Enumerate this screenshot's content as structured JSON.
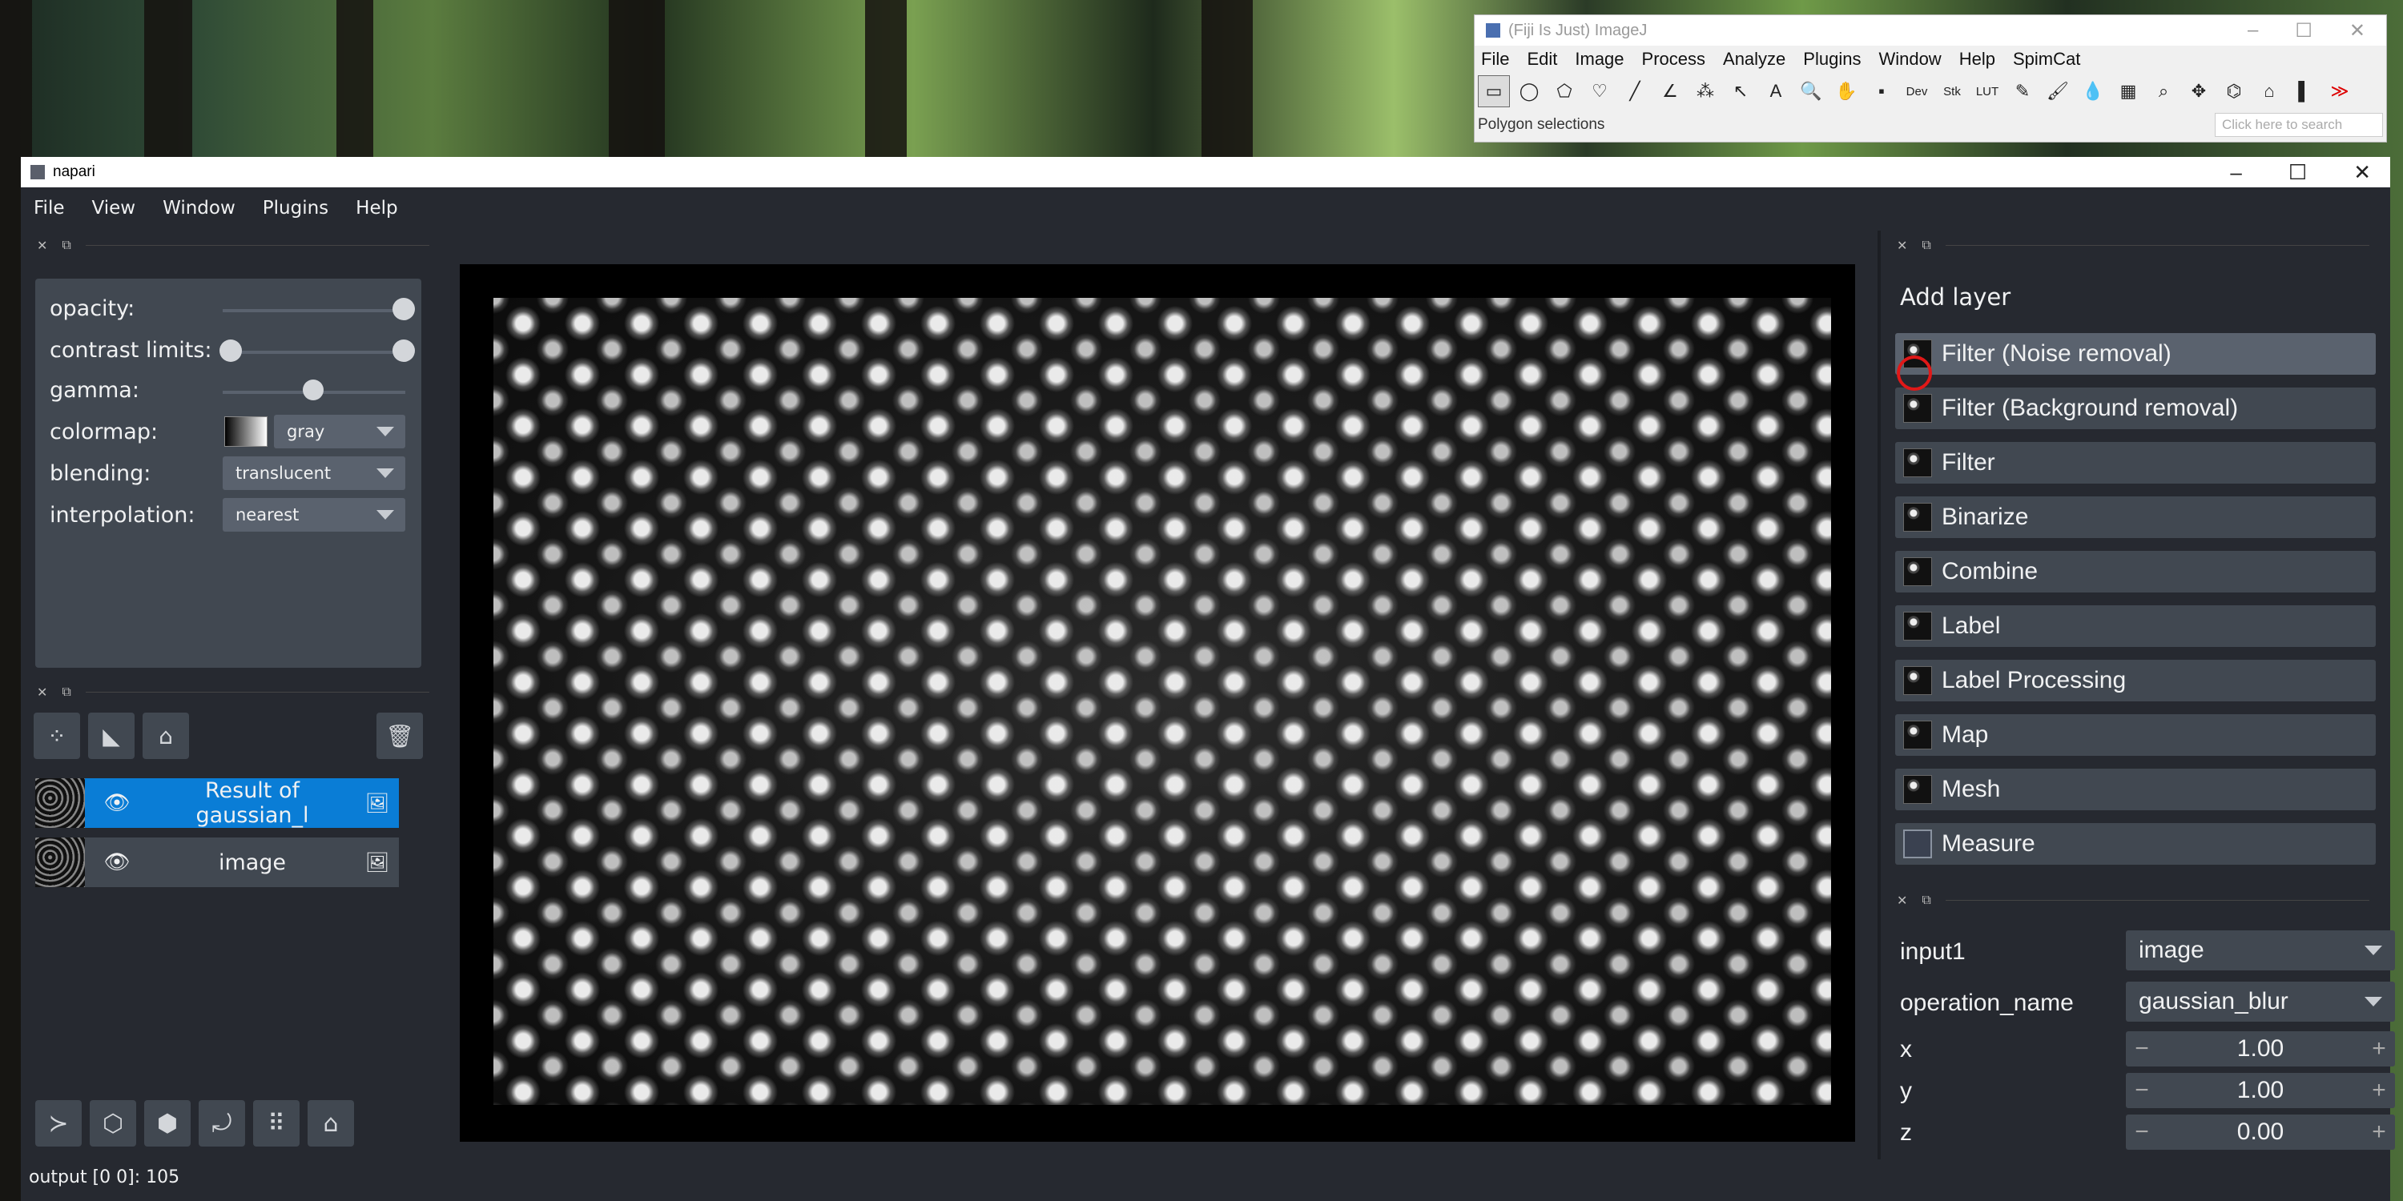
{
  "imagej": {
    "title": "(Fiji Is Just) ImageJ",
    "menu": [
      "File",
      "Edit",
      "Image",
      "Process",
      "Analyze",
      "Plugins",
      "Window",
      "Help",
      "SpimCat"
    ],
    "tools": [
      "▭",
      "◯",
      "⬠",
      "♡",
      "╱",
      "∠",
      "⁂",
      "↖",
      "A",
      "🔍",
      "✋",
      "▪",
      "Dev",
      "Stk",
      "LUT",
      "✎",
      "🖌",
      "💧",
      "▦",
      "⌕",
      "✥",
      "⌬",
      "⌂",
      "▌",
      "≫"
    ],
    "status": "Polygon selections",
    "search_placeholder": "Click here to search"
  },
  "napari": {
    "title": "napari",
    "menu": [
      "File",
      "View",
      "Window",
      "Plugins",
      "Help"
    ],
    "layer_controls": {
      "opacity_label": "opacity:",
      "contrast_label": "contrast limits:",
      "gamma_label": "gamma:",
      "colormap_label": "colormap:",
      "colormap_value": "gray",
      "blending_label": "blending:",
      "blending_value": "translucent",
      "interpolation_label": "interpolation:",
      "interpolation_value": "nearest",
      "opacity": 1.0,
      "gamma": 0.5
    },
    "layers": [
      {
        "name": "Result of gaussian_l",
        "selected": true
      },
      {
        "name": "image",
        "selected": false
      }
    ],
    "add_layer": {
      "title": "Add layer",
      "buttons": [
        "Filter (Noise removal)",
        "Filter (Background removal)",
        "Filter",
        "Binarize",
        "Combine",
        "Label",
        "Label Processing",
        "Map",
        "Mesh",
        "Measure"
      ]
    },
    "params": {
      "input1_label": "input1",
      "input1_value": "image",
      "operation_label": "operation_name",
      "operation_value": "gaussian_blur",
      "x_label": "x",
      "x_value": "1.00",
      "y_label": "y",
      "y_value": "1.00",
      "z_label": "z",
      "z_value": "0.00"
    },
    "status": "output [0 0]: 105"
  }
}
